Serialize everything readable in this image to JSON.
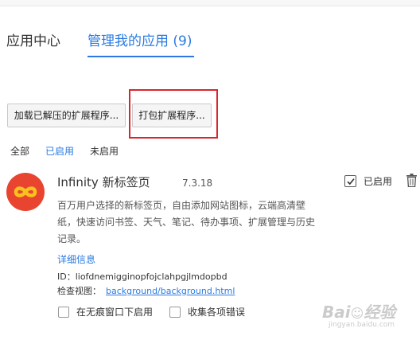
{
  "tabs": {
    "app_center": "应用中心",
    "manage_apps": "管理我的应用 (9)"
  },
  "buttons": {
    "load_unpacked": "加载已解压的扩展程序...",
    "pack_extension": "打包扩展程序..."
  },
  "filters": {
    "all": "全部",
    "enabled": "已启用",
    "disabled": "未启用"
  },
  "extension": {
    "name": "Infinity 新标签页",
    "version": "7.3.18",
    "enabled_label": "已启用",
    "enabled": true,
    "description": "百万用户选择的新标签页，自由添加网站图标，云端高清壁纸，快速访问书签、天气、笔记、待办事项、扩展管理与历史记录。",
    "details_link": "详细信息",
    "id_label": "ID：",
    "id_value": "liofdnemigginopfojclahpgjlmdopbd",
    "inspect_label": "检查视图：",
    "inspect_link": "background/background.html",
    "option_incognito": "在无痕窗口下启用",
    "option_errors": "收集各项错误",
    "icon": "infinity-icon"
  },
  "colors": {
    "accent": "#2a7ae2",
    "icon_bg": "#e8442f",
    "highlight": "#d9262b"
  }
}
